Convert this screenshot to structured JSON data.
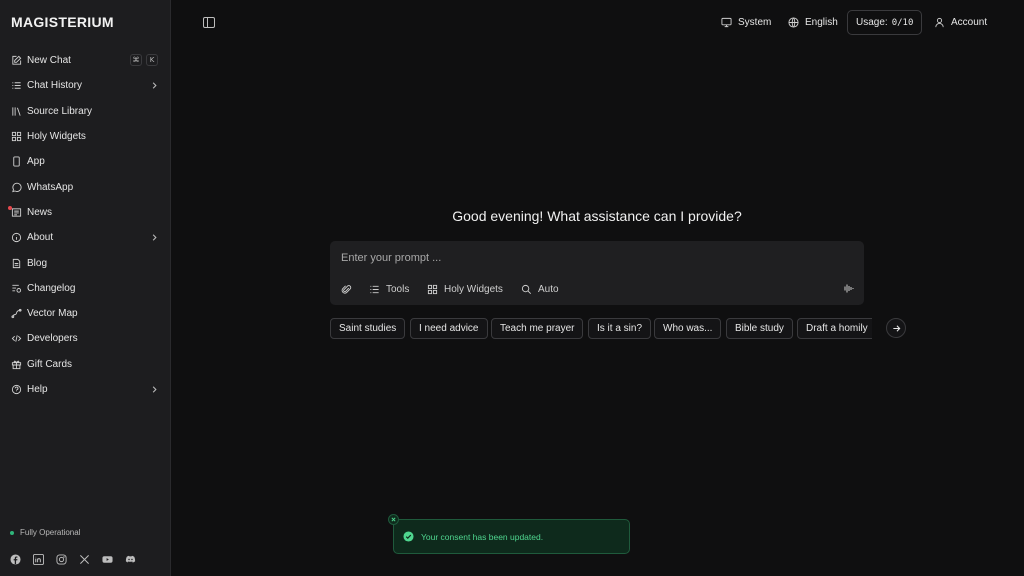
{
  "app": {
    "logo": "MAGISTERIUM"
  },
  "sidebar": {
    "items": [
      {
        "label": "New Chat",
        "icon": "edit-icon"
      },
      {
        "label": "Chat History",
        "icon": "history-icon"
      },
      {
        "label": "Source Library",
        "icon": "library-icon"
      },
      {
        "label": "Holy Widgets",
        "icon": "grid-icon"
      },
      {
        "label": "App",
        "icon": "phone-icon"
      },
      {
        "label": "WhatsApp",
        "icon": "whatsapp-icon"
      },
      {
        "label": "News",
        "icon": "newspaper-icon"
      },
      {
        "label": "About",
        "icon": "info-icon"
      },
      {
        "label": "Blog",
        "icon": "document-icon"
      },
      {
        "label": "Changelog",
        "icon": "changelog-icon"
      },
      {
        "label": "Vector Map",
        "icon": "vector-map-icon"
      },
      {
        "label": "Developers",
        "icon": "code-icon"
      },
      {
        "label": "Gift Cards",
        "icon": "gift-icon"
      },
      {
        "label": "Help",
        "icon": "help-icon"
      }
    ],
    "shortcut": {
      "k1": "⌘",
      "k2": "K"
    },
    "status": "Fully Operational",
    "status_color": "#2fb57a",
    "news_badge_color": "#e5484d"
  },
  "topbar": {
    "system_label": "System",
    "language_label": "English",
    "usage_label": "Usage:",
    "usage_value": "0/10",
    "account_label": "Account"
  },
  "main": {
    "greeting": "Good evening! What assistance can I provide?",
    "prompt_placeholder": "Enter your prompt ...",
    "tools_label": "Tools",
    "widgets_label": "Holy Widgets",
    "auto_label": "Auto",
    "chips": [
      "Saint studies",
      "I need advice",
      "Teach me prayer",
      "Is it a sin?",
      "Who was...",
      "Bible study",
      "Draft a homily"
    ]
  },
  "toast": {
    "message": "Your consent has been updated.",
    "color": "#4fd68f"
  }
}
